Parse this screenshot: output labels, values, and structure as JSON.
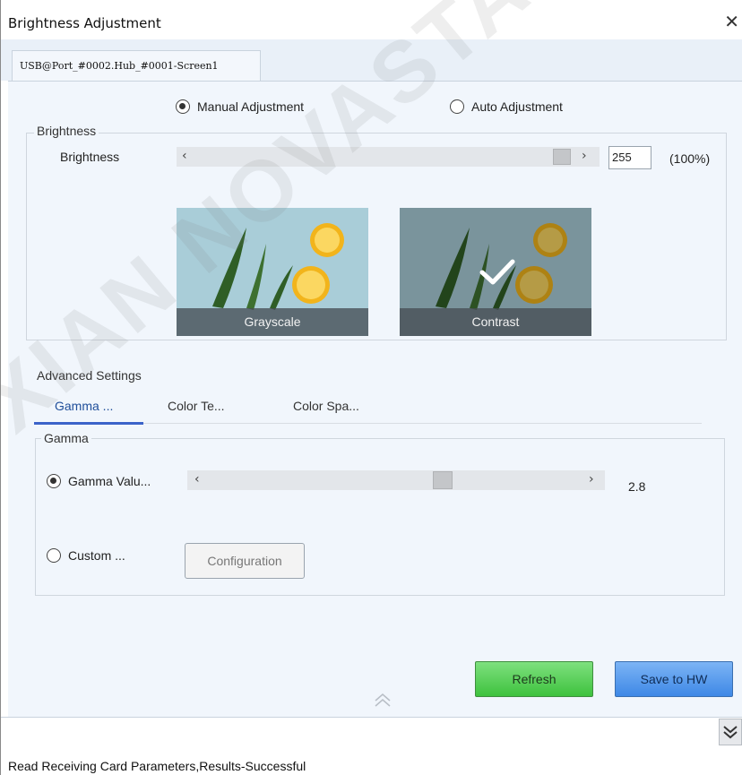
{
  "window": {
    "title": "Brightness Adjustment"
  },
  "doc_tab": {
    "label": "USB@Port_#0002.Hub_#0001-Screen1"
  },
  "mode": {
    "manual_label": "Manual Adjustment",
    "auto_label": "Auto Adjustment",
    "selected": "manual"
  },
  "brightness": {
    "group_label": "Brightness",
    "label": "Brightness",
    "value": "255",
    "percent": "(100%)",
    "level_fraction": 1.0
  },
  "presets": {
    "grayscale_label": "Grayscale",
    "contrast_label": "Contrast",
    "selected": "contrast"
  },
  "advanced": {
    "group_label": "Advanced Settings",
    "tabs": [
      {
        "label": "Gamma ...",
        "active": true
      },
      {
        "label": "Color Te...",
        "active": false
      },
      {
        "label": "Color Spa...",
        "active": false
      }
    ],
    "gamma": {
      "group_label": "Gamma",
      "value_label": "Gamma Valu...",
      "value": "2.8",
      "custom_label": "Custom ...",
      "configuration_label": "Configuration",
      "selected": "value"
    }
  },
  "actions": {
    "refresh_label": "Refresh",
    "save_label": "Save to HW"
  },
  "status": {
    "text": "Read Receiving Card Parameters,Results-Successful"
  },
  "watermark": {
    "text": "XIAN NOVASTAR TECH CO"
  },
  "icons": {
    "close": "close-icon",
    "collapse": "chevron-up-double-icon",
    "expand": "chevron-down-double-icon",
    "check": "checkmark-icon"
  },
  "colors": {
    "accent_tab": "#3b63c9",
    "refresh": "#4ccb4c",
    "save": "#4a90e8",
    "panel_bg": "#f1f6fc"
  }
}
